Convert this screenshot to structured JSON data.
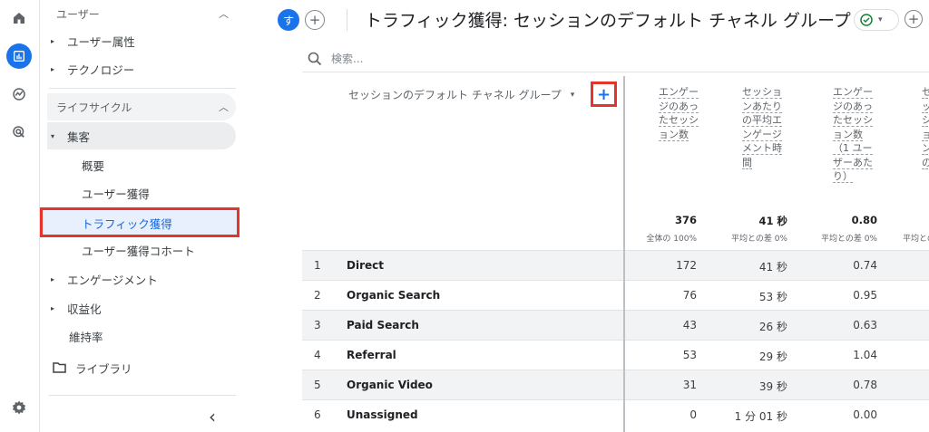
{
  "header": {
    "avatar_letter": "す",
    "title": "トラフィック獲得: セッションのデフォルト チャネル グループ",
    "add": "+"
  },
  "sidebar": {
    "section_user": "ユーザー",
    "user_attributes": "ユーザー属性",
    "technology": "テクノロジー",
    "section_lifecycle": "ライフサイクル",
    "acquisition": "集客",
    "acq_overview": "概要",
    "acq_user_acquisition": "ユーザー獲得",
    "acq_traffic_acquisition": "トラフィック獲得",
    "acq_user_cohort": "ユーザー獲得コホート",
    "engagement": "エンゲージメント",
    "monetization": "収益化",
    "retention": "維持率",
    "library": "ライブラリ",
    "collapse": "‹"
  },
  "search": {
    "placeholder": "検索..."
  },
  "table": {
    "dimension_header": "セッションのデフォルト チャネル グループ",
    "dropdown": "▾",
    "add_dimension": "+",
    "metrics": [
      {
        "label": "エンゲージのあったセッション数",
        "total": "376",
        "sub": "全体の 100%"
      },
      {
        "label": "セッションあたりの平均エンゲージメント時間",
        "total": "41 秒",
        "sub": "平均との差 0%"
      },
      {
        "label": "エンゲージのあったセッション数（1 ユーザーあたり）",
        "total": "0.80",
        "sub": "平均との差 0%"
      },
      {
        "label": "セッ ション の",
        "total": "",
        "sub": "平均との差"
      }
    ],
    "rows": [
      {
        "n": "1",
        "name": "Direct",
        "v1": "172",
        "v2": "41 秒",
        "v3": "0.74"
      },
      {
        "n": "2",
        "name": "Organic Search",
        "v1": "76",
        "v2": "53 秒",
        "v3": "0.95"
      },
      {
        "n": "3",
        "name": "Paid Search",
        "v1": "43",
        "v2": "26 秒",
        "v3": "0.63"
      },
      {
        "n": "4",
        "name": "Referral",
        "v1": "53",
        "v2": "29 秒",
        "v3": "1.04"
      },
      {
        "n": "5",
        "name": "Organic Video",
        "v1": "31",
        "v2": "39 秒",
        "v3": "0.78"
      },
      {
        "n": "6",
        "name": "Unassigned",
        "v1": "0",
        "v2": "1 分 01 秒",
        "v3": "0.00"
      }
    ]
  },
  "colors": {
    "accent": "#1a73e8",
    "highlight_border": "#e5352a",
    "selected_bg": "#e8f0fe"
  }
}
